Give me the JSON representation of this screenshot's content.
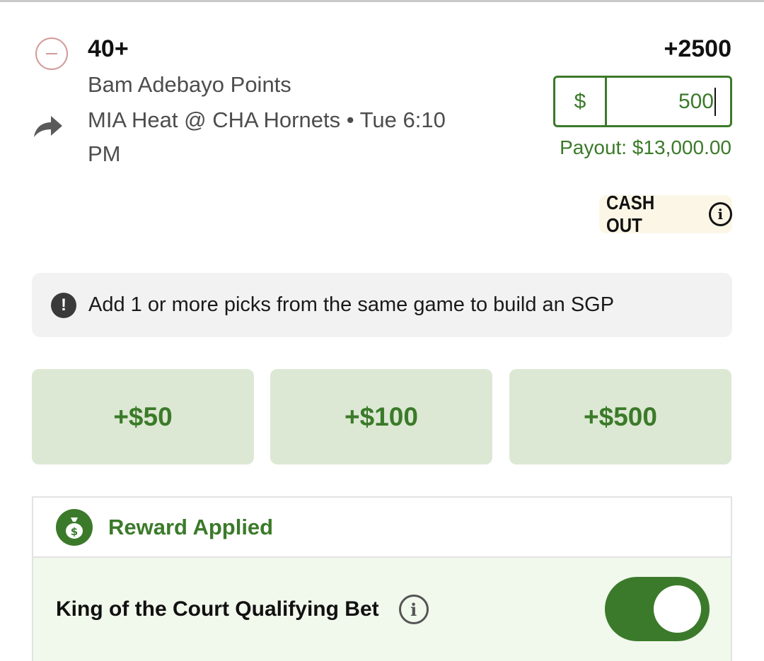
{
  "leg": {
    "line": "40+",
    "market": "Bam Adebayo Points",
    "event": "MIA Heat @ CHA Hornets • Tue 6:10 PM",
    "odds": "+2500"
  },
  "wager": {
    "currency": "$",
    "amount": "500",
    "payout": "Payout: $13,000.00"
  },
  "cash_out": {
    "label": "CASH OUT"
  },
  "sgp_notice": {
    "text": "Add 1 or more picks from the same game to build an SGP"
  },
  "quick_stakes": [
    "+$50",
    "+$100",
    "+$500"
  ],
  "reward": {
    "title": "Reward Applied",
    "qualifying_label": "King of the Court Qualifying Bet",
    "toggle_on": true
  },
  "colors": {
    "accent_green": "#3b7a2a",
    "stake_button_bg": "#dce8d3",
    "remove_red": "#d49a9a",
    "cashout_bg": "#fbf6e6"
  }
}
